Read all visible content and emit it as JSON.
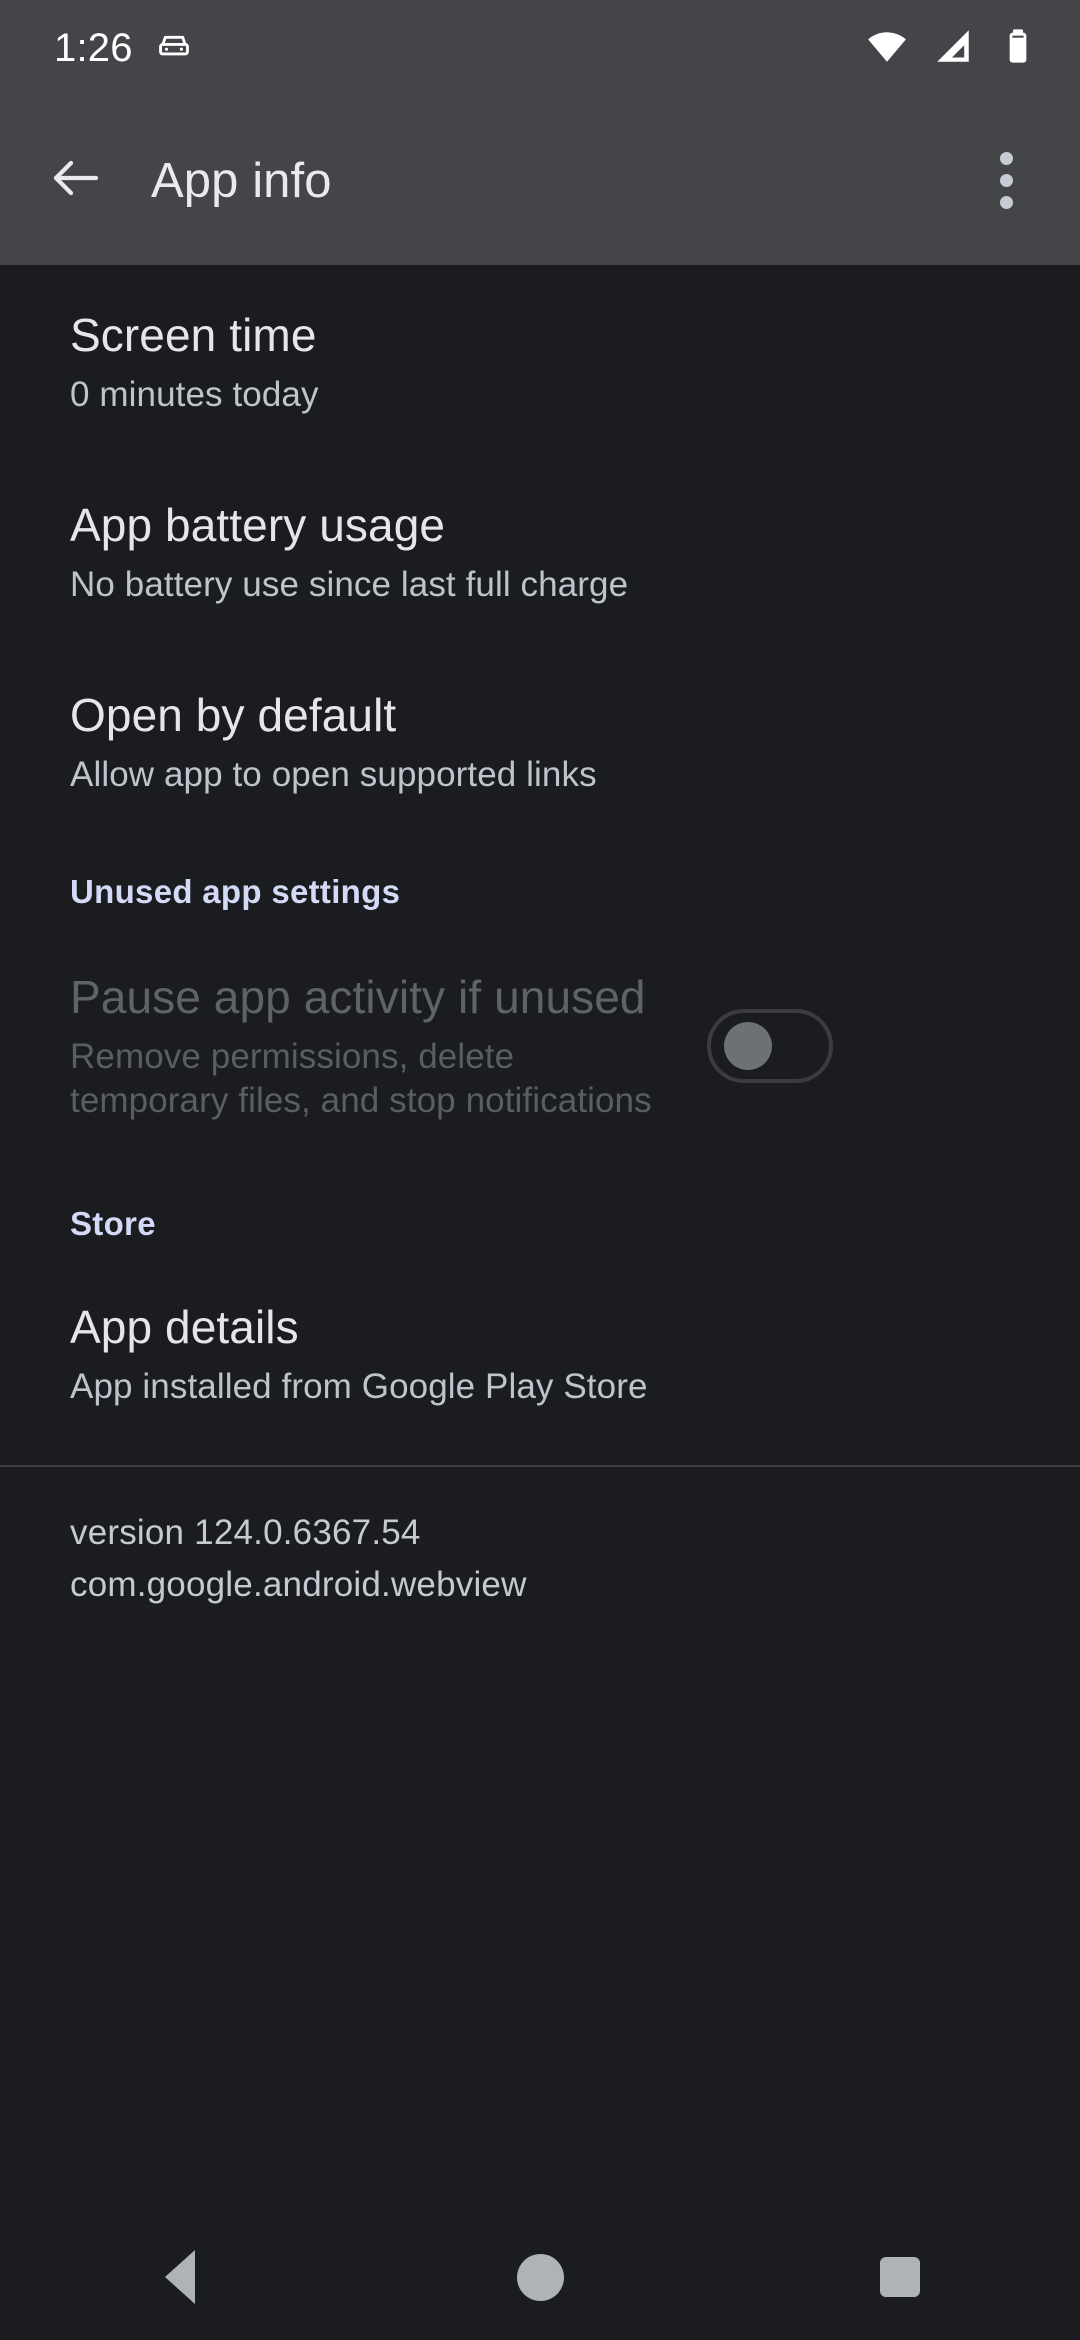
{
  "status_bar": {
    "clock": "1:26",
    "icons": [
      "car-icon",
      "wifi-icon",
      "cell-signal-icon",
      "battery-icon"
    ]
  },
  "app_bar": {
    "back_icon": "arrow-back-icon",
    "title": "App info",
    "overflow_icon": "more-vert-icon"
  },
  "preferences": [
    {
      "title": "Screen time",
      "summary": "0 minutes today"
    },
    {
      "title": "App battery usage",
      "summary": "No battery use since last full charge"
    },
    {
      "title": "Open by default",
      "summary": "Allow app to open supported links"
    }
  ],
  "unused_section": {
    "header": "Unused app settings",
    "item": {
      "title": "Pause app activity if unused",
      "summary": "Remove permissions, delete temporary files, and stop notifications",
      "switch_state": "off"
    }
  },
  "store_section": {
    "header": "Store",
    "item": {
      "title": "App details",
      "summary": "App installed from Google Play Store"
    }
  },
  "footer": {
    "version": "version 124.0.6367.54",
    "package": "com.google.android.webview"
  },
  "nav_bar": {
    "back": "nav-back-icon",
    "home": "nav-home-icon",
    "recents": "nav-recents-icon"
  },
  "colors": {
    "app_bar_bg": "#434549",
    "content_bg": "#1B1C1F",
    "accent": "#D3DAF6",
    "primary_text": "#E5E6EA",
    "secondary_text": "#BFC3CB",
    "disabled_text": "#5F6266"
  }
}
